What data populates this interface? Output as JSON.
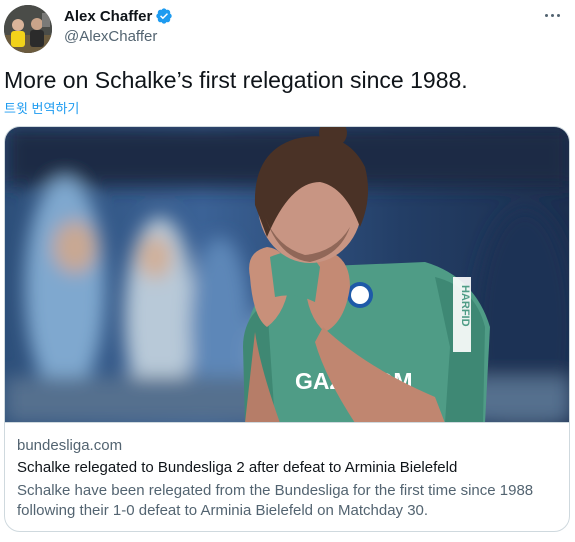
{
  "tweet": {
    "author": {
      "display_name": "Alex Chaffer",
      "handle": "@AlexChaffer",
      "verified_icon": "verified-badge-icon",
      "verified_color": "#1d9bf0"
    },
    "more_icon": "more-horizontal-icon",
    "text": "More on Schalke’s first relegation since 1988.",
    "translate_label": "트윗 번역하기",
    "card": {
      "image_shirt_sponsor": "GAZPROM",
      "image_sleeve_brand": "HARFID",
      "domain": "bundesliga.com",
      "title": "Schalke relegated to Bundesliga 2 after defeat to Arminia Bielefeld",
      "description": "Schalke have been relegated from the Bundesliga for the first time since 1988 following their 1-0 defeat to Arminia Bielefeld on Matchday 30."
    }
  },
  "colors": {
    "text_primary": "#0f1419",
    "text_secondary": "#536471",
    "link": "#1d9bf0",
    "border": "#cfd9de",
    "jersey_green": "#4f9c86"
  }
}
